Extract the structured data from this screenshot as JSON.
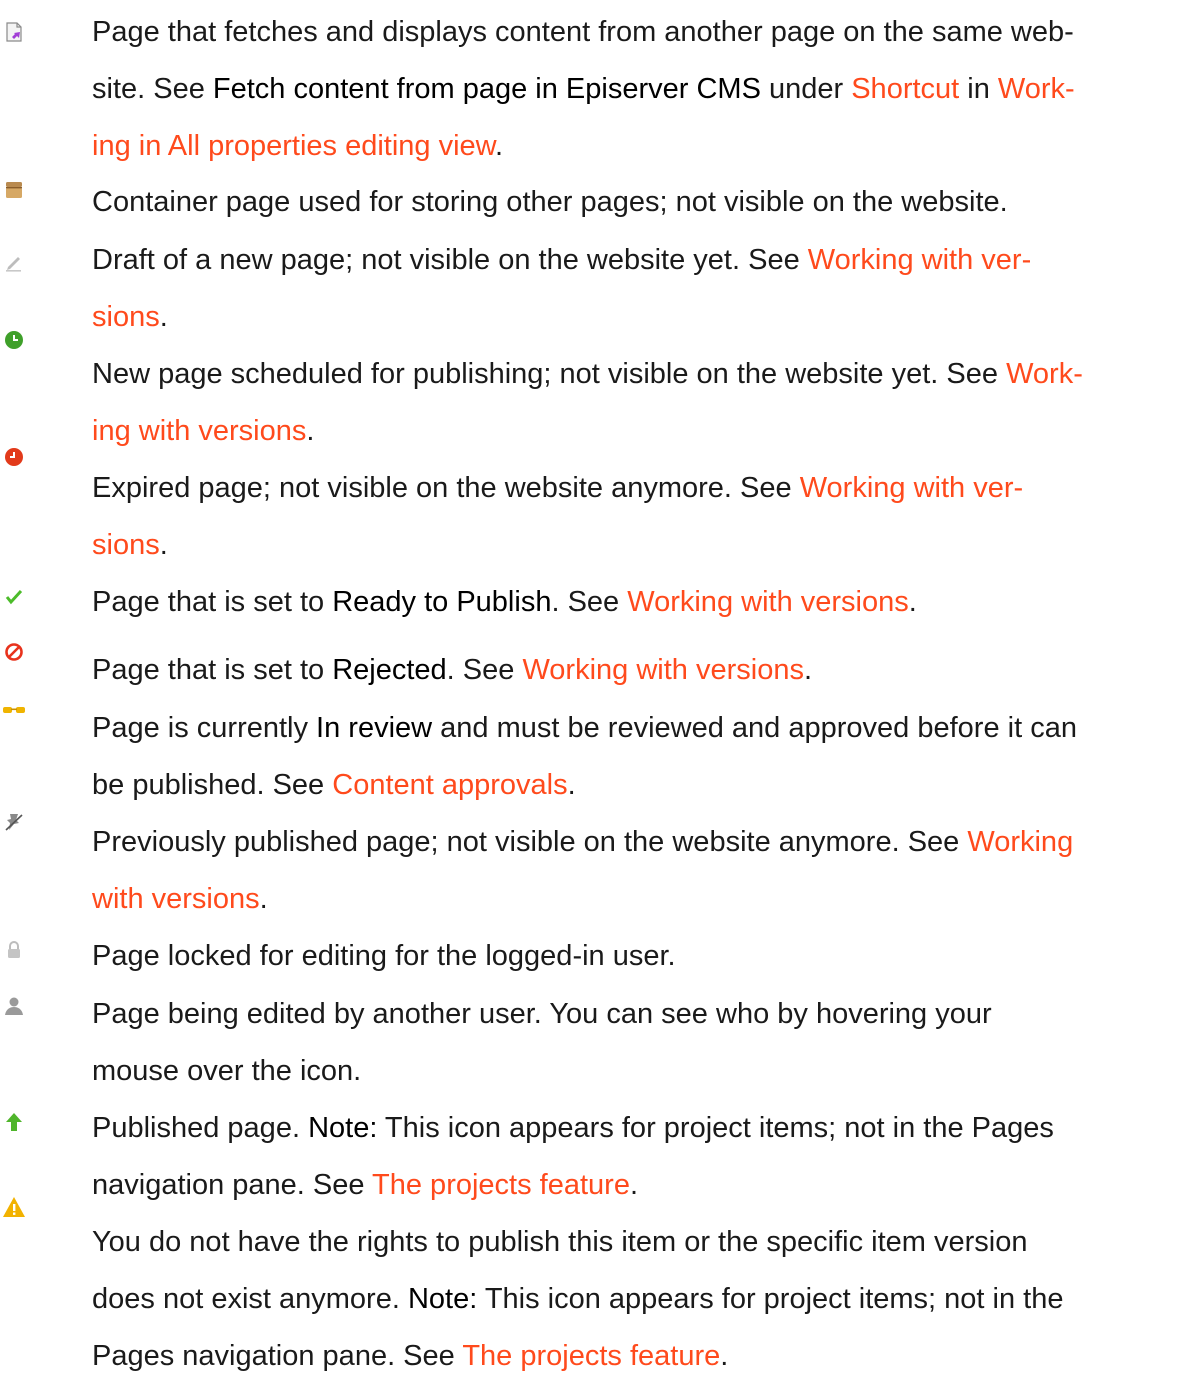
{
  "entries": [
    {
      "icon": "page-shortcut-icon",
      "segments": [
        {
          "t": "text",
          "v": "Page that fetches and displays content from another page on the same web-"
        },
        {
          "t": "br"
        },
        {
          "t": "text",
          "v": "site. See "
        },
        {
          "t": "strong",
          "v": "Fetch content from page in Episerver CMS"
        },
        {
          "t": "text",
          "v": " under "
        },
        {
          "t": "link",
          "v": "Shortcut"
        },
        {
          "t": "text",
          "v": " in "
        },
        {
          "t": "link",
          "v": "Work-"
        },
        {
          "t": "br"
        },
        {
          "t": "link",
          "v": "ing in All properties editing view"
        },
        {
          "t": "text",
          "v": "."
        }
      ]
    },
    {
      "icon": "container-page-icon",
      "segments": [
        {
          "t": "text",
          "v": "Container page used for storing other pages; not visible on the website."
        }
      ]
    },
    {
      "icon": "draft-pencil-icon",
      "segments": [
        {
          "t": "text",
          "v": "Draft of a new page; not visible on the website yet. See "
        },
        {
          "t": "link",
          "v": "Working with ver-"
        },
        {
          "t": "br"
        },
        {
          "t": "link",
          "v": "sions"
        },
        {
          "t": "text",
          "v": "."
        }
      ]
    },
    {
      "icon": "scheduled-clock-icon",
      "segments": [
        {
          "t": "text",
          "v": "New page scheduled for publishing; not visible on the website yet. See "
        },
        {
          "t": "link",
          "v": "Work-"
        },
        {
          "t": "br"
        },
        {
          "t": "link",
          "v": "ing with versions"
        },
        {
          "t": "text",
          "v": "."
        }
      ]
    },
    {
      "icon": "expired-clock-icon",
      "segments": [
        {
          "t": "text",
          "v": "Expired page; not visible on the website anymore. See "
        },
        {
          "t": "link",
          "v": "Working with ver-"
        },
        {
          "t": "br"
        },
        {
          "t": "link",
          "v": "sions"
        },
        {
          "t": "text",
          "v": "."
        }
      ]
    },
    {
      "icon": "checkmark-icon",
      "segments": [
        {
          "t": "text",
          "v": "Page that is set to "
        },
        {
          "t": "strong",
          "v": "Ready to Publish"
        },
        {
          "t": "text",
          "v": ". See "
        },
        {
          "t": "link",
          "v": "Working with versions"
        },
        {
          "t": "text",
          "v": "."
        }
      ]
    },
    {
      "icon": "rejected-icon",
      "segments": [
        {
          "t": "text",
          "v": "Page that is set to "
        },
        {
          "t": "strong",
          "v": "Rejected"
        },
        {
          "t": "text",
          "v": ". See "
        },
        {
          "t": "link",
          "v": "Working with versions"
        },
        {
          "t": "text",
          "v": "."
        }
      ]
    },
    {
      "icon": "in-review-glasses-icon",
      "segments": [
        {
          "t": "text",
          "v": "Page is currently "
        },
        {
          "t": "strong",
          "v": "In review"
        },
        {
          "t": "text",
          "v": " and must be reviewed and approved before it can"
        },
        {
          "t": "br"
        },
        {
          "t": "text",
          "v": "be published. See "
        },
        {
          "t": "link",
          "v": "Content approvals"
        },
        {
          "t": "text",
          "v": "."
        }
      ]
    },
    {
      "icon": "unpublished-pin-icon",
      "segments": [
        {
          "t": "text",
          "v": "Previously published page; not visible on the website anymore. See "
        },
        {
          "t": "link",
          "v": "Working"
        },
        {
          "t": "br"
        },
        {
          "t": "link",
          "v": "with versions"
        },
        {
          "t": "text",
          "v": "."
        }
      ]
    },
    {
      "icon": "lock-icon",
      "segments": [
        {
          "t": "text",
          "v": "Page locked for editing for the logged-in user."
        }
      ]
    },
    {
      "icon": "user-icon",
      "segments": [
        {
          "t": "text",
          "v": "Page being edited by another user. You can see who by hovering your"
        },
        {
          "t": "br"
        },
        {
          "t": "text",
          "v": "mouse over the icon."
        }
      ]
    },
    {
      "icon": "published-arrow-up-icon",
      "segments": [
        {
          "t": "text",
          "v": "Published page. "
        },
        {
          "t": "strong",
          "v": "Note:"
        },
        {
          "t": "text",
          "v": " This icon appears for project items; not in the Pages"
        },
        {
          "t": "br"
        },
        {
          "t": "text",
          "v": "navigation pane. See "
        },
        {
          "t": "link",
          "v": "The projects feature"
        },
        {
          "t": "text",
          "v": "."
        }
      ]
    },
    {
      "icon": "warning-icon",
      "segments": [
        {
          "t": "text",
          "v": "You do not have the rights to publish this item or the specific item version"
        },
        {
          "t": "br"
        },
        {
          "t": "text",
          "v": "does not exist anymore. "
        },
        {
          "t": "strong",
          "v": "Note:"
        },
        {
          "t": "text",
          "v": " This icon appears for project items; not in the"
        },
        {
          "t": "br"
        },
        {
          "t": "text",
          "v": "Pages navigation pane. See "
        },
        {
          "t": "link",
          "v": "The projects feature"
        },
        {
          "t": "text",
          "v": "."
        }
      ]
    }
  ],
  "colors": {
    "link": "#ff4a1c",
    "text": "#1a1a1a"
  }
}
